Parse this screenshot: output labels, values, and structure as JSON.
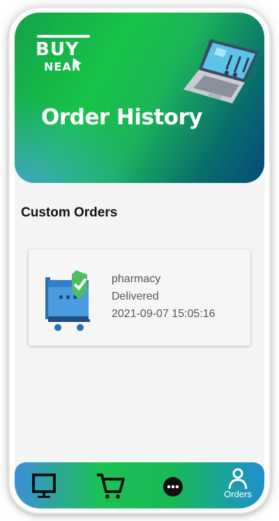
{
  "header": {
    "logo_top": "BUY",
    "logo_bottom": "NEAR",
    "title": "Order History"
  },
  "section": {
    "title": "Custom Orders"
  },
  "orders": [
    {
      "category": "pharmacy",
      "status": "Delivered",
      "datetime": "2021-09-07 15:05:16",
      "icon": "cart-check-icon"
    }
  ],
  "bottom_nav": {
    "items": [
      {
        "icon": "monitor-icon",
        "label": ""
      },
      {
        "icon": "cart-icon",
        "label": ""
      },
      {
        "icon": "more-icon",
        "label": ""
      },
      {
        "icon": "user-icon",
        "label": "Orders"
      }
    ]
  },
  "colors": {
    "accent_green": "#16c447",
    "accent_blue": "#1f8fcf",
    "card_bg": "#f6f6f6"
  }
}
